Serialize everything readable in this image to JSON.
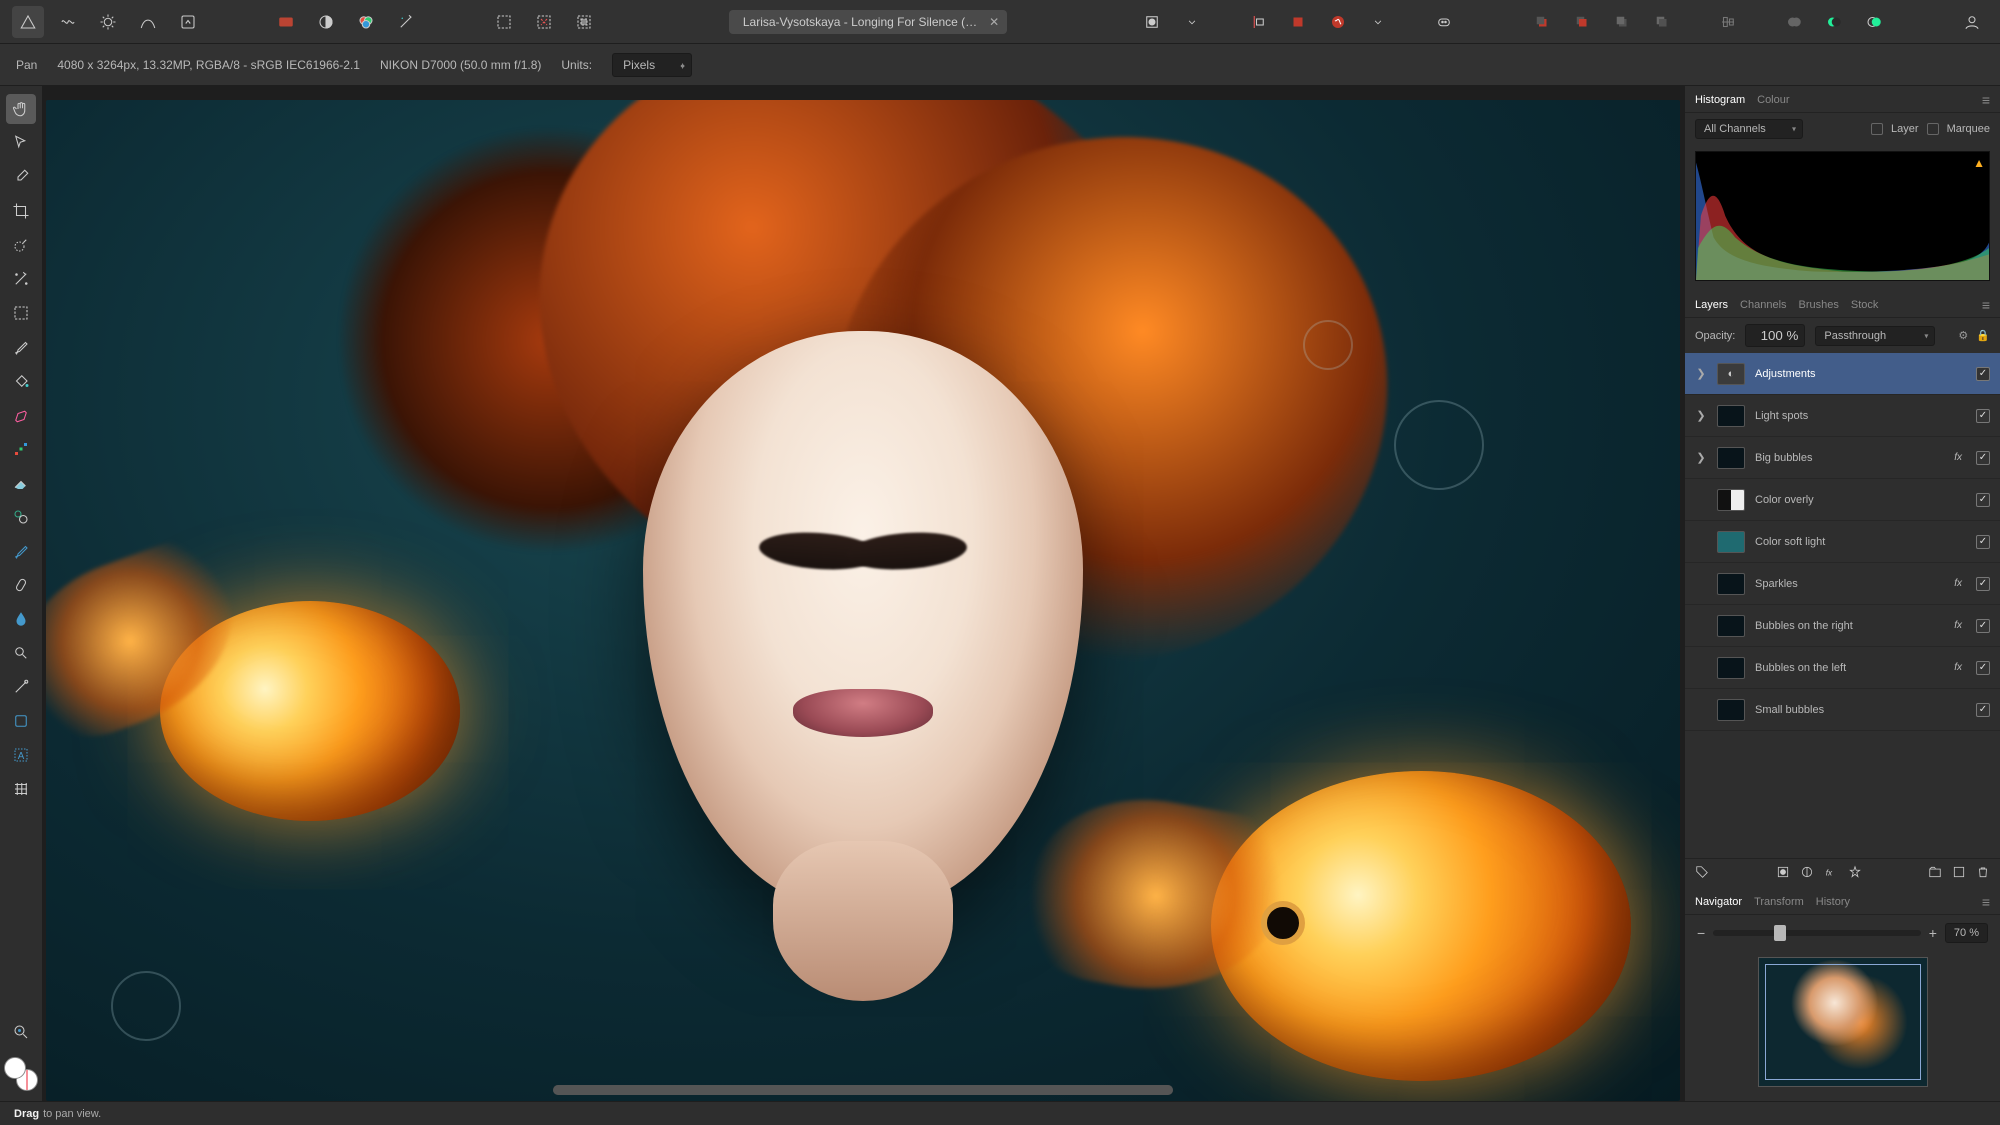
{
  "document": {
    "title": "Larisa-Vysotskaya - Longing For Silence (…"
  },
  "context": {
    "tool": "Pan",
    "info": "4080 x 3264px, 13.32MP, RGBA/8 - sRGB IEC61966-2.1",
    "camera": "NIKON D7000 (50.0 mm f/1.8)",
    "units_label": "Units:",
    "units_value": "Pixels"
  },
  "histogram": {
    "tabs": [
      "Histogram",
      "Colour"
    ],
    "channel": "All Channels",
    "opt_layer": "Layer",
    "opt_marquee": "Marquee"
  },
  "layers_panel": {
    "tabs": [
      "Layers",
      "Channels",
      "Brushes",
      "Stock"
    ],
    "opacity_label": "Opacity:",
    "opacity_value": "100 %",
    "blend": "Passthrough",
    "items": [
      {
        "name": "Adjustments",
        "fx": false,
        "sel": true,
        "exp": true,
        "thumb": "adj"
      },
      {
        "name": "Light spots",
        "fx": false,
        "sel": false,
        "exp": true,
        "thumb": "dark"
      },
      {
        "name": "Big bubbles",
        "fx": true,
        "sel": false,
        "exp": true,
        "thumb": "dark"
      },
      {
        "name": "Color overly",
        "fx": false,
        "sel": false,
        "exp": false,
        "thumb": "mask"
      },
      {
        "name": "Color soft light",
        "fx": false,
        "sel": false,
        "exp": false,
        "thumb": "teal"
      },
      {
        "name": "Sparkles",
        "fx": true,
        "sel": false,
        "exp": false,
        "thumb": "dark"
      },
      {
        "name": "Bubbles on the right",
        "fx": true,
        "sel": false,
        "exp": false,
        "thumb": "dark"
      },
      {
        "name": "Bubbles on the left",
        "fx": true,
        "sel": false,
        "exp": false,
        "thumb": "dark"
      },
      {
        "name": "Small bubbles",
        "fx": false,
        "sel": false,
        "exp": false,
        "thumb": "dark"
      }
    ],
    "fx_label": "fx"
  },
  "navigator": {
    "tabs": [
      "Navigator",
      "Transform",
      "History"
    ],
    "zoom": "70 %",
    "knob_pct": 32
  },
  "status": {
    "action": "Drag",
    "msg": " to pan view."
  }
}
